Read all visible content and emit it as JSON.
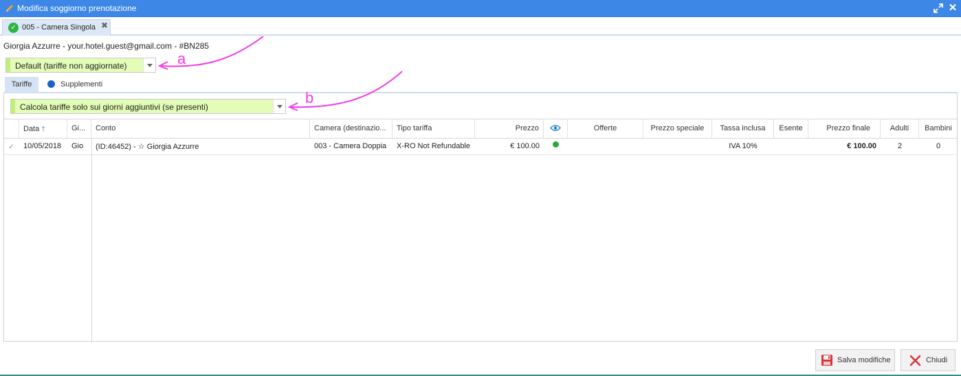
{
  "window": {
    "title": "Modifica soggiorno prenotazione"
  },
  "tab": {
    "label": "005 - Camera Singola"
  },
  "guest_line": "Giorgia Azzurre - your.hotel.guest@gmail.com - #BN285",
  "rate_select": {
    "value": "Default (tariffe non aggiornate)"
  },
  "subtabs": {
    "tariffe": "Tariffe",
    "supplementi": "Supplementi"
  },
  "calc_select": {
    "value": "Calcola tariffe solo sui giorni aggiuntivi (se presenti)"
  },
  "annotations": {
    "a": "a",
    "b": "b",
    "color": "#f23ce8"
  },
  "table": {
    "headers": {
      "data": "Data",
      "giorno": "Gi...",
      "conto": "Conto",
      "camera": "Camera (destinazio...",
      "tipo": "Tipo tariffa",
      "prezzo": "Prezzo",
      "offerte": "Offerte",
      "prezzo_speciale": "Prezzo speciale",
      "tassa": "Tassa inclusa",
      "esente": "Esente",
      "prezzo_finale": "Prezzo finale",
      "adulti": "Adulti",
      "bambini": "Bambini"
    },
    "rows": [
      {
        "check": "✓",
        "data": "10/05/2018",
        "giorno": "Gio",
        "conto": "(ID:46452) - ☆ Giorgia Azzurre",
        "camera": "003 - Camera Doppia",
        "tipo": "X-RO Not Refundable",
        "prezzo": "€ 100.00",
        "visible_status_color": "#27a83a",
        "offerte": "",
        "prezzo_speciale": "",
        "tassa": "IVA 10%",
        "esente": "",
        "prezzo_finale": "€ 100.00",
        "adulti": "2",
        "bambini": "0"
      }
    ]
  },
  "buttons": {
    "save": "Salva modifiche",
    "close": "Chiudi"
  },
  "colors": {
    "titlebar": "#3d87e6",
    "select_bg": "#e3fcb7",
    "accent_green": "#c1f07a"
  }
}
